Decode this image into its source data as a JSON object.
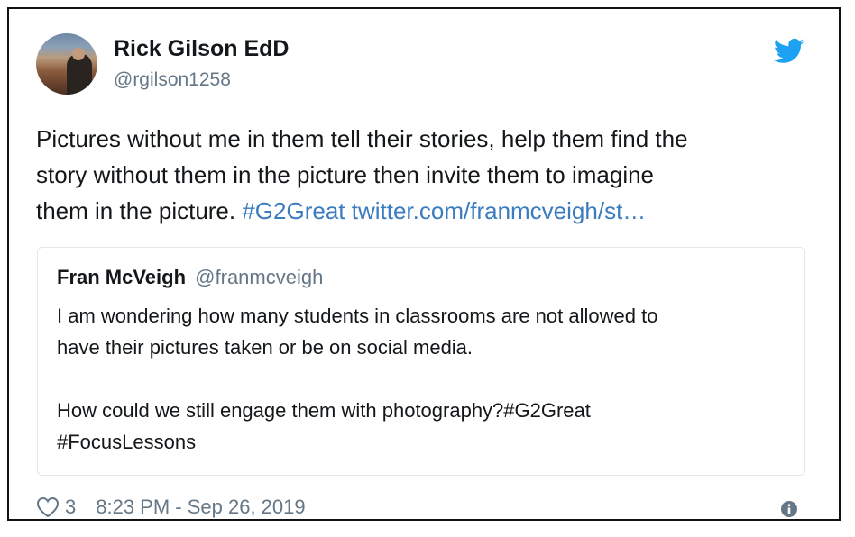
{
  "author": {
    "display_name": "Rick Gilson EdD",
    "handle": "@rgilson1258"
  },
  "tweet": {
    "text_line1": "Pictures without me in them tell their stories, help them find the",
    "text_line2": "story without them in the picture then invite them to imagine",
    "text_line3": "them  in the picture. ",
    "hashtag": "#G2Great",
    "link": "twitter.com/franmcveigh/st…"
  },
  "quoted_tweet": {
    "display_name": "Fran McVeigh",
    "handle": "@franmcveigh",
    "line1": "I am wondering how many students in classrooms are not allowed to",
    "line2": "have their pictures taken or be on social media.",
    "line3": "How could we still engage them with photography?#G2Great",
    "line4": "#FocusLessons"
  },
  "footer": {
    "like_count": "3",
    "timestamp": "8:23 PM - Sep 26, 2019"
  },
  "icons": {
    "brand": "twitter-bird-icon",
    "like": "heart-icon",
    "info": "info-icon"
  },
  "colors": {
    "link": "#3b7cc0",
    "twitter_blue": "#1da1f2",
    "muted": "#657786",
    "text": "#14171a"
  }
}
